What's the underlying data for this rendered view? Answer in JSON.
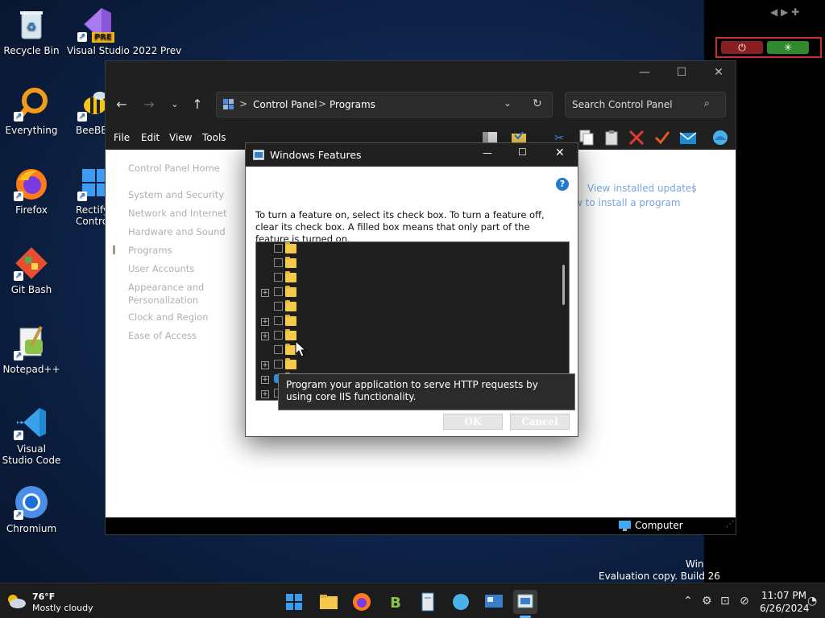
{
  "desktop_icons": [
    {
      "label": "Recycle Bin",
      "icon": "recycle-bin-icon"
    },
    {
      "label": "Visual Studio 2022 Prev",
      "badge": "PRE",
      "icon": "visual-studio-2022-icon"
    },
    {
      "label": "Everything",
      "icon": "everything-search-icon"
    },
    {
      "label": "BeeBEE",
      "icon": "beebeep-icon"
    },
    {
      "label": "Firefox",
      "icon": "firefox-icon"
    },
    {
      "label": "Rectify Contro",
      "icon": "rectify11-control-icon"
    },
    {
      "label": "Git Bash",
      "icon": "git-bash-icon"
    },
    {
      "label": "Notepad++",
      "icon": "notepad-plus-plus-icon"
    },
    {
      "label": "Visual Studio Code",
      "icon": "vscode-icon"
    },
    {
      "label": "Chromium",
      "icon": "chromium-icon"
    }
  ],
  "explorer": {
    "address": {
      "root": "Control Panel",
      "sep": ">",
      "current": "Programs"
    },
    "search_placeholder": "Search Control Panel",
    "menu": [
      "File",
      "Edit",
      "View",
      "Tools"
    ],
    "sidebar": [
      "Control Panel Home",
      "System and Security",
      "Network and Internet",
      "Hardware and Sound",
      "Programs",
      "User Accounts",
      "Appearance and Personalization",
      "Clock and Region",
      "Ease of Access"
    ],
    "links": {
      "view_updates": "View installed updates",
      "how_install": "w to install a program"
    },
    "status": "Computer"
  },
  "dialog": {
    "title": "Windows Features",
    "instructions": "To turn a feature on, select its check box. To turn a feature off, clear its check box. A filled box means that only part of the feature is turned on.",
    "tooltip": "Program your application to serve HTTP requests by using core IIS functionality.",
    "ok": "OK",
    "cancel": "Cancel"
  },
  "watermark": {
    "line1": "Win",
    "line2": "Evaluation copy. Build 26"
  },
  "taskbar": {
    "weather_temp": "76°F",
    "weather_desc": "Mostly cloudy",
    "time": "11:07 PM",
    "date": "6/26/2024"
  },
  "colors": {
    "desktop": "#112a55",
    "accent": "#2e8fd8",
    "link": "#1a73e8",
    "folder": "#f5c94a"
  }
}
